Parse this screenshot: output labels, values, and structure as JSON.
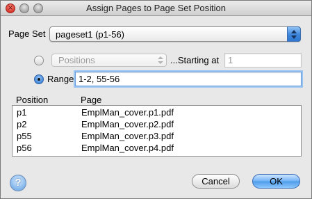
{
  "window": {
    "title": "Assign Pages to Page Set Position"
  },
  "page_set": {
    "label": "Page Set",
    "value": "pageset1 (p1-56)"
  },
  "positions_option": {
    "dropdown_value": "Positions",
    "starting_label": "...Starting at",
    "starting_value": "1",
    "selected": false
  },
  "range_option": {
    "label": "Range",
    "value": "1-2, 55-56",
    "selected": true
  },
  "table": {
    "headers": [
      "Position",
      "Page"
    ],
    "rows": [
      {
        "position": "p1",
        "page": "EmplMan_cover.p1.pdf"
      },
      {
        "position": "p2",
        "page": "EmplMan_cover.p2.pdf"
      },
      {
        "position": "p55",
        "page": "EmplMan_cover.p3.pdf"
      },
      {
        "position": "p56",
        "page": "EmplMan_cover.p4.pdf"
      }
    ]
  },
  "buttons": {
    "help": "?",
    "cancel": "Cancel",
    "ok": "OK"
  },
  "colors": {
    "accent": "#4d9be8",
    "window_bg": "#e8e8e8"
  }
}
